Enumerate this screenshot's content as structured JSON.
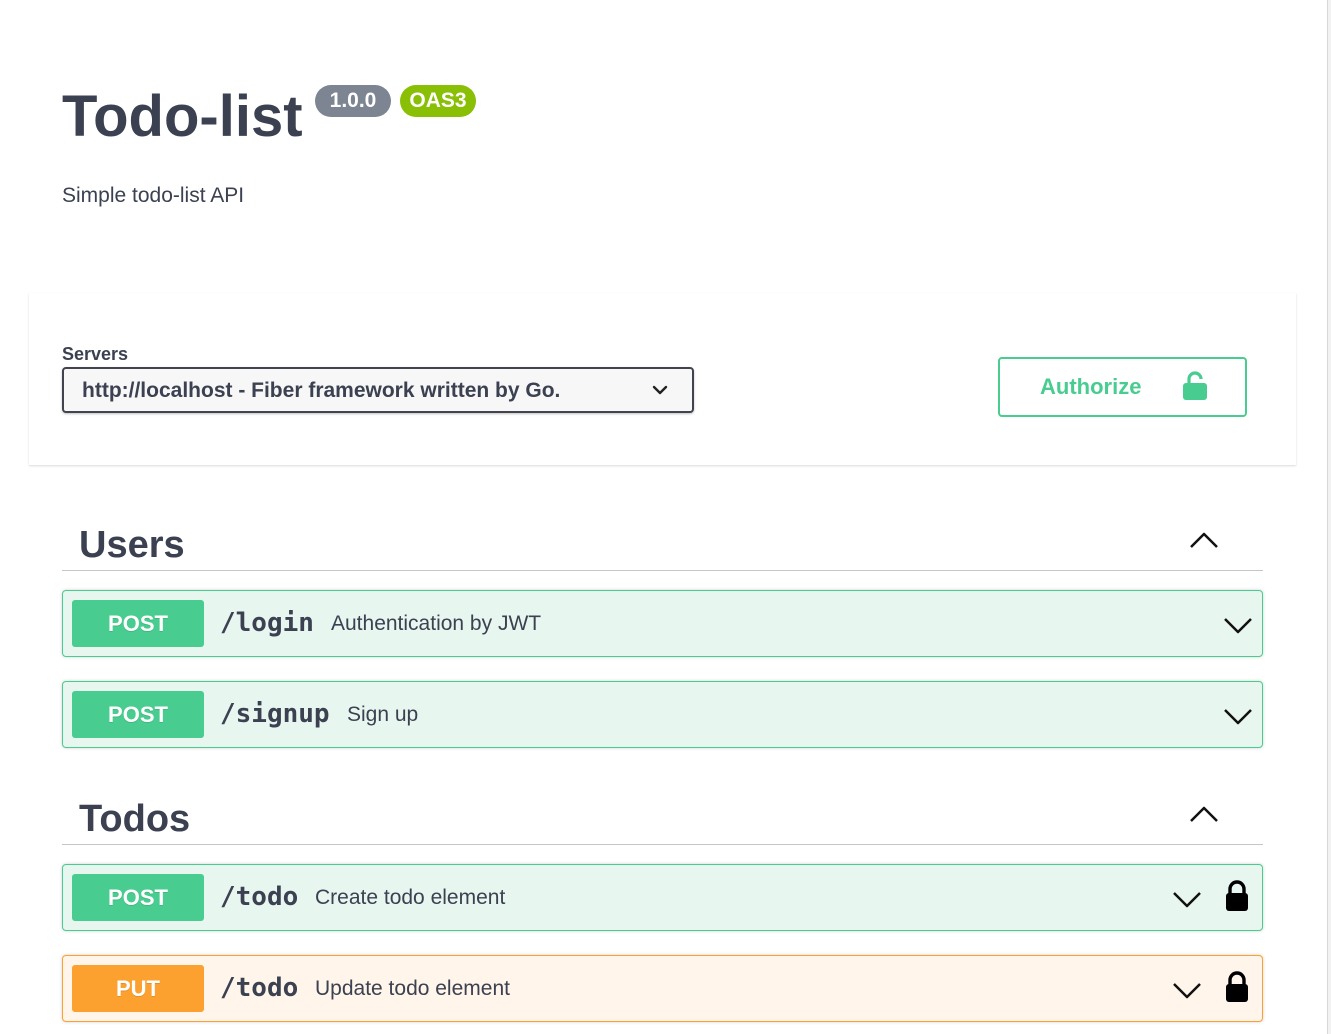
{
  "info": {
    "title": "Todo-list",
    "version": "1.0.0",
    "oas": "OAS3",
    "description": "Simple todo-list API"
  },
  "servers": {
    "label": "Servers",
    "selected": "http://localhost - Fiber framework written by Go."
  },
  "authorize": {
    "label": "Authorize"
  },
  "tags": [
    {
      "name": "Users",
      "operations": [
        {
          "method": "POST",
          "path": "/login",
          "summary": "Authentication by JWT",
          "locked": false
        },
        {
          "method": "POST",
          "path": "/signup",
          "summary": "Sign up",
          "locked": false
        }
      ]
    },
    {
      "name": "Todos",
      "operations": [
        {
          "method": "POST",
          "path": "/todo",
          "summary": "Create todo element",
          "locked": true
        },
        {
          "method": "PUT",
          "path": "/todo",
          "summary": "Update todo element",
          "locked": true
        }
      ]
    }
  ],
  "icons": {
    "servers_dropdown": "chevron-down-icon",
    "authorize": "unlocked-lock-icon",
    "tag_toggle": "chevron-up-icon",
    "op_expand": "chevron-down-icon",
    "op_auth": "locked-lock-icon"
  },
  "colors": {
    "post": "#49cc90",
    "put": "#fca130",
    "version_badge": "#7d8492",
    "oas_badge": "#89bf04",
    "text": "#3b4151"
  }
}
